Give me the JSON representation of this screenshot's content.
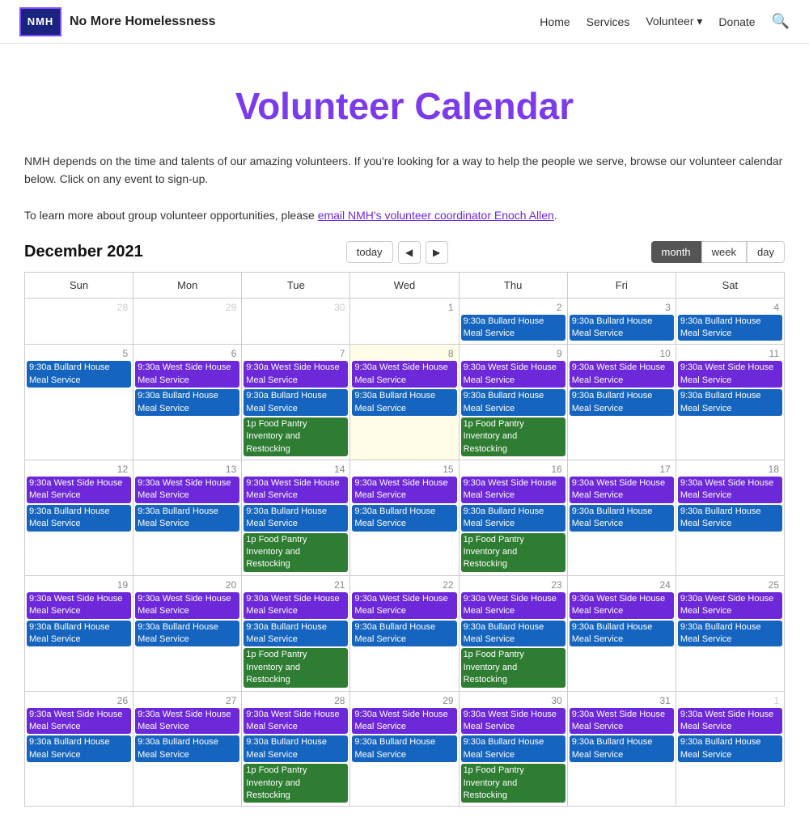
{
  "nav": {
    "logo_acronym": "NMH",
    "logo_full": "No More Homelessness",
    "links": [
      {
        "label": "Home",
        "dropdown": false
      },
      {
        "label": "Services",
        "dropdown": false
      },
      {
        "label": "Volunteer",
        "dropdown": true
      },
      {
        "label": "Donate",
        "dropdown": true
      }
    ]
  },
  "page": {
    "title": "Volunteer Calendar",
    "intro1": "NMH depends on the time and talents of our amazing volunteers. If you're looking for a way to help the people we serve, browse our volunteer calendar below. Click on any event to sign-up.",
    "intro2": "To learn more about group volunteer opportunities, please ",
    "intro_link": "email NMH's volunteer coordinator Enoch Allen",
    "intro2_end": "."
  },
  "calendar": {
    "month_label": "December 2021",
    "today_btn": "today",
    "view_btns": [
      "month",
      "week",
      "day"
    ],
    "active_view": "month",
    "days_of_week": [
      "Sun",
      "Mon",
      "Tue",
      "Wed",
      "Thu",
      "Fri",
      "Sat"
    ],
    "events": {
      "bullard": "9:30a Bullard House Meal Service",
      "westside": "9:30a West Side House Meal Service",
      "foodpantry": "1p Food Pantry Inventory and Restocking"
    }
  }
}
